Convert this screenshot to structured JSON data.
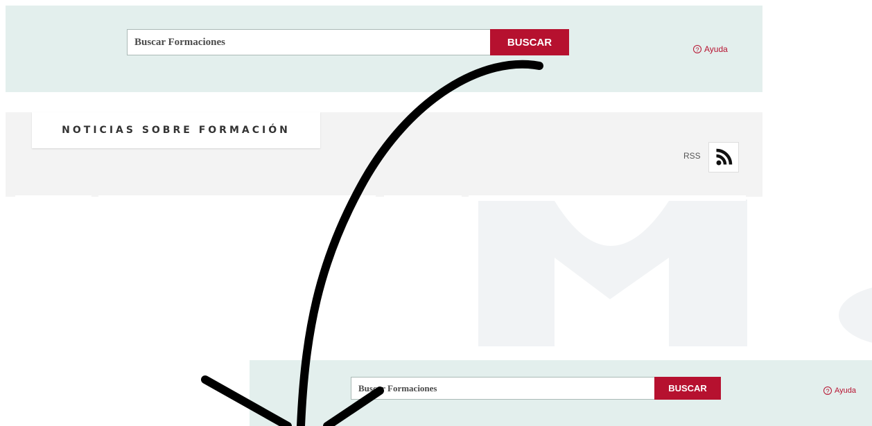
{
  "top_search": {
    "placeholder": "Buscar Formaciones",
    "button_label": "BUSCAR",
    "help_label": "Ayuda",
    "help_icon": "?"
  },
  "news": {
    "title": "NOTICIAS SOBRE FORMACIÓN",
    "rss_label": "RSS",
    "rss_icon": "rss-icon"
  },
  "bottom_search": {
    "placeholder": "Buscar Formaciones",
    "button_label": "BUSCAR",
    "help_label": "Ayuda",
    "help_icon": "?"
  },
  "colors": {
    "accent": "#b6112f",
    "search_panel_bg": "#e3efed",
    "news_panel_bg": "#f3f3f3",
    "arrow": "#000000"
  }
}
